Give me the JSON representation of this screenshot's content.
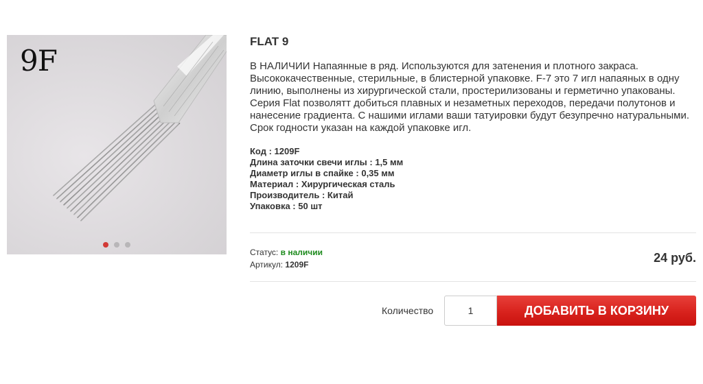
{
  "product": {
    "image": {
      "corner_text": "9F",
      "slides_count": 3,
      "active_slide": 1
    },
    "title": "FLAT 9",
    "description": "В НАЛИЧИИ Напаянные в ряд. Используются для затенения и плотного закраса. Высококачественные, стерильные, в блистерной упаковке. F-7 это 7 игл напаяных в одну линию, выполнены из хирургической стали, простерилизованы и герметично упакованы. Серия Flat позволятт добиться плавных и незаметных переходов, передачи полутонов и нанесение градиента. С нашими иглами ваши татуировки будут безупречно натуральными. Срок годности указан на каждой упаковке игл.",
    "specs": [
      {
        "label": "Код",
        "value": "1209F"
      },
      {
        "label": "Длина заточки свечи иглы",
        "value": "1,5 мм"
      },
      {
        "label": "Диаметр иглы в спайке",
        "value": "0,35 мм"
      },
      {
        "label": "Материал",
        "value": "Хирургическая сталь"
      },
      {
        "label": "Производитель",
        "value": "Китай"
      },
      {
        "label": "Упаковка",
        "value": "50 шт"
      }
    ],
    "status_label": "Статус:",
    "status_value": "в наличии",
    "sku_label": "Артикул:",
    "sku_value": "1209F",
    "price": "24 руб."
  },
  "purchase": {
    "quantity_label": "Количество",
    "quantity_value": "1",
    "add_to_cart_label": "ДОБАВИТЬ В КОРЗИНУ"
  },
  "colors": {
    "accent": "#d8221d",
    "status_ok": "#1c8a1c",
    "active_dot": "#d23a36"
  }
}
